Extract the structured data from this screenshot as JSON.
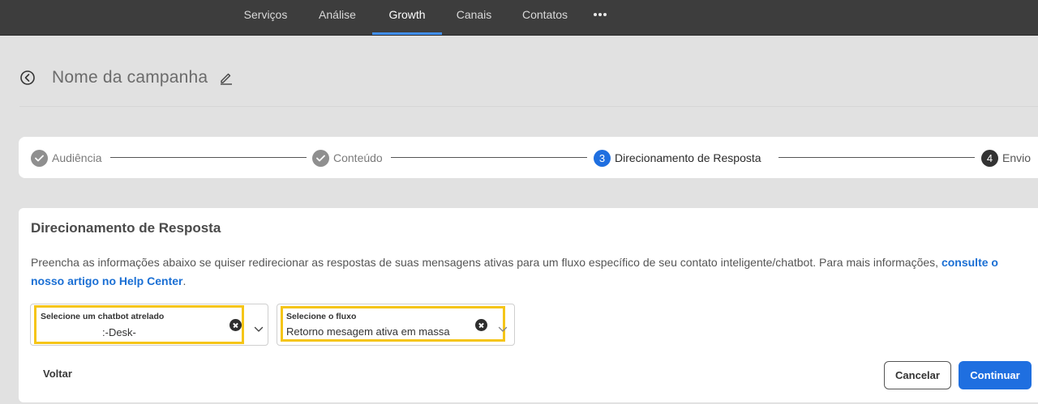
{
  "nav": {
    "items": [
      {
        "label": "Serviços"
      },
      {
        "label": "Análise"
      },
      {
        "label": "Growth"
      },
      {
        "label": "Canais"
      },
      {
        "label": "Contatos"
      }
    ],
    "active": "Growth",
    "more_icon": "more-horizontal-icon"
  },
  "header": {
    "title": "Nome da campanha",
    "back_icon": "back-circle-icon",
    "edit_icon": "pencil-icon"
  },
  "stepper": {
    "steps": [
      {
        "number": "1",
        "label": "Audiência",
        "state": "done"
      },
      {
        "number": "2",
        "label": "Conteúdo",
        "state": "done"
      },
      {
        "number": "3",
        "label": "Direcionamento de Resposta",
        "state": "active"
      },
      {
        "number": "4",
        "label": "Envio",
        "state": "todo"
      }
    ]
  },
  "card": {
    "title": "Direcionamento de Resposta",
    "description": "Preencha as informações abaixo se quiser redirecionar as respostas de suas mensagens ativas para um fluxo específico de seu contato inteligente/chatbot. Para mais informações,",
    "link_text": "consulte o nosso artigo no Help Center",
    "description_end": ".",
    "chatbot_select": {
      "label": "Selecione um chatbot atrelado",
      "value": ":-Desk-"
    },
    "flow_select": {
      "label": "Selecione o fluxo",
      "value": "Retorno mesagem ativa em massa"
    }
  },
  "actions": {
    "back_label": "Voltar",
    "cancel_label": "Cancelar",
    "continue_label": "Continuar"
  },
  "colors": {
    "accent": "#1f6fe0",
    "highlight": "#f5c518",
    "topbar": "#3d3d3d"
  }
}
